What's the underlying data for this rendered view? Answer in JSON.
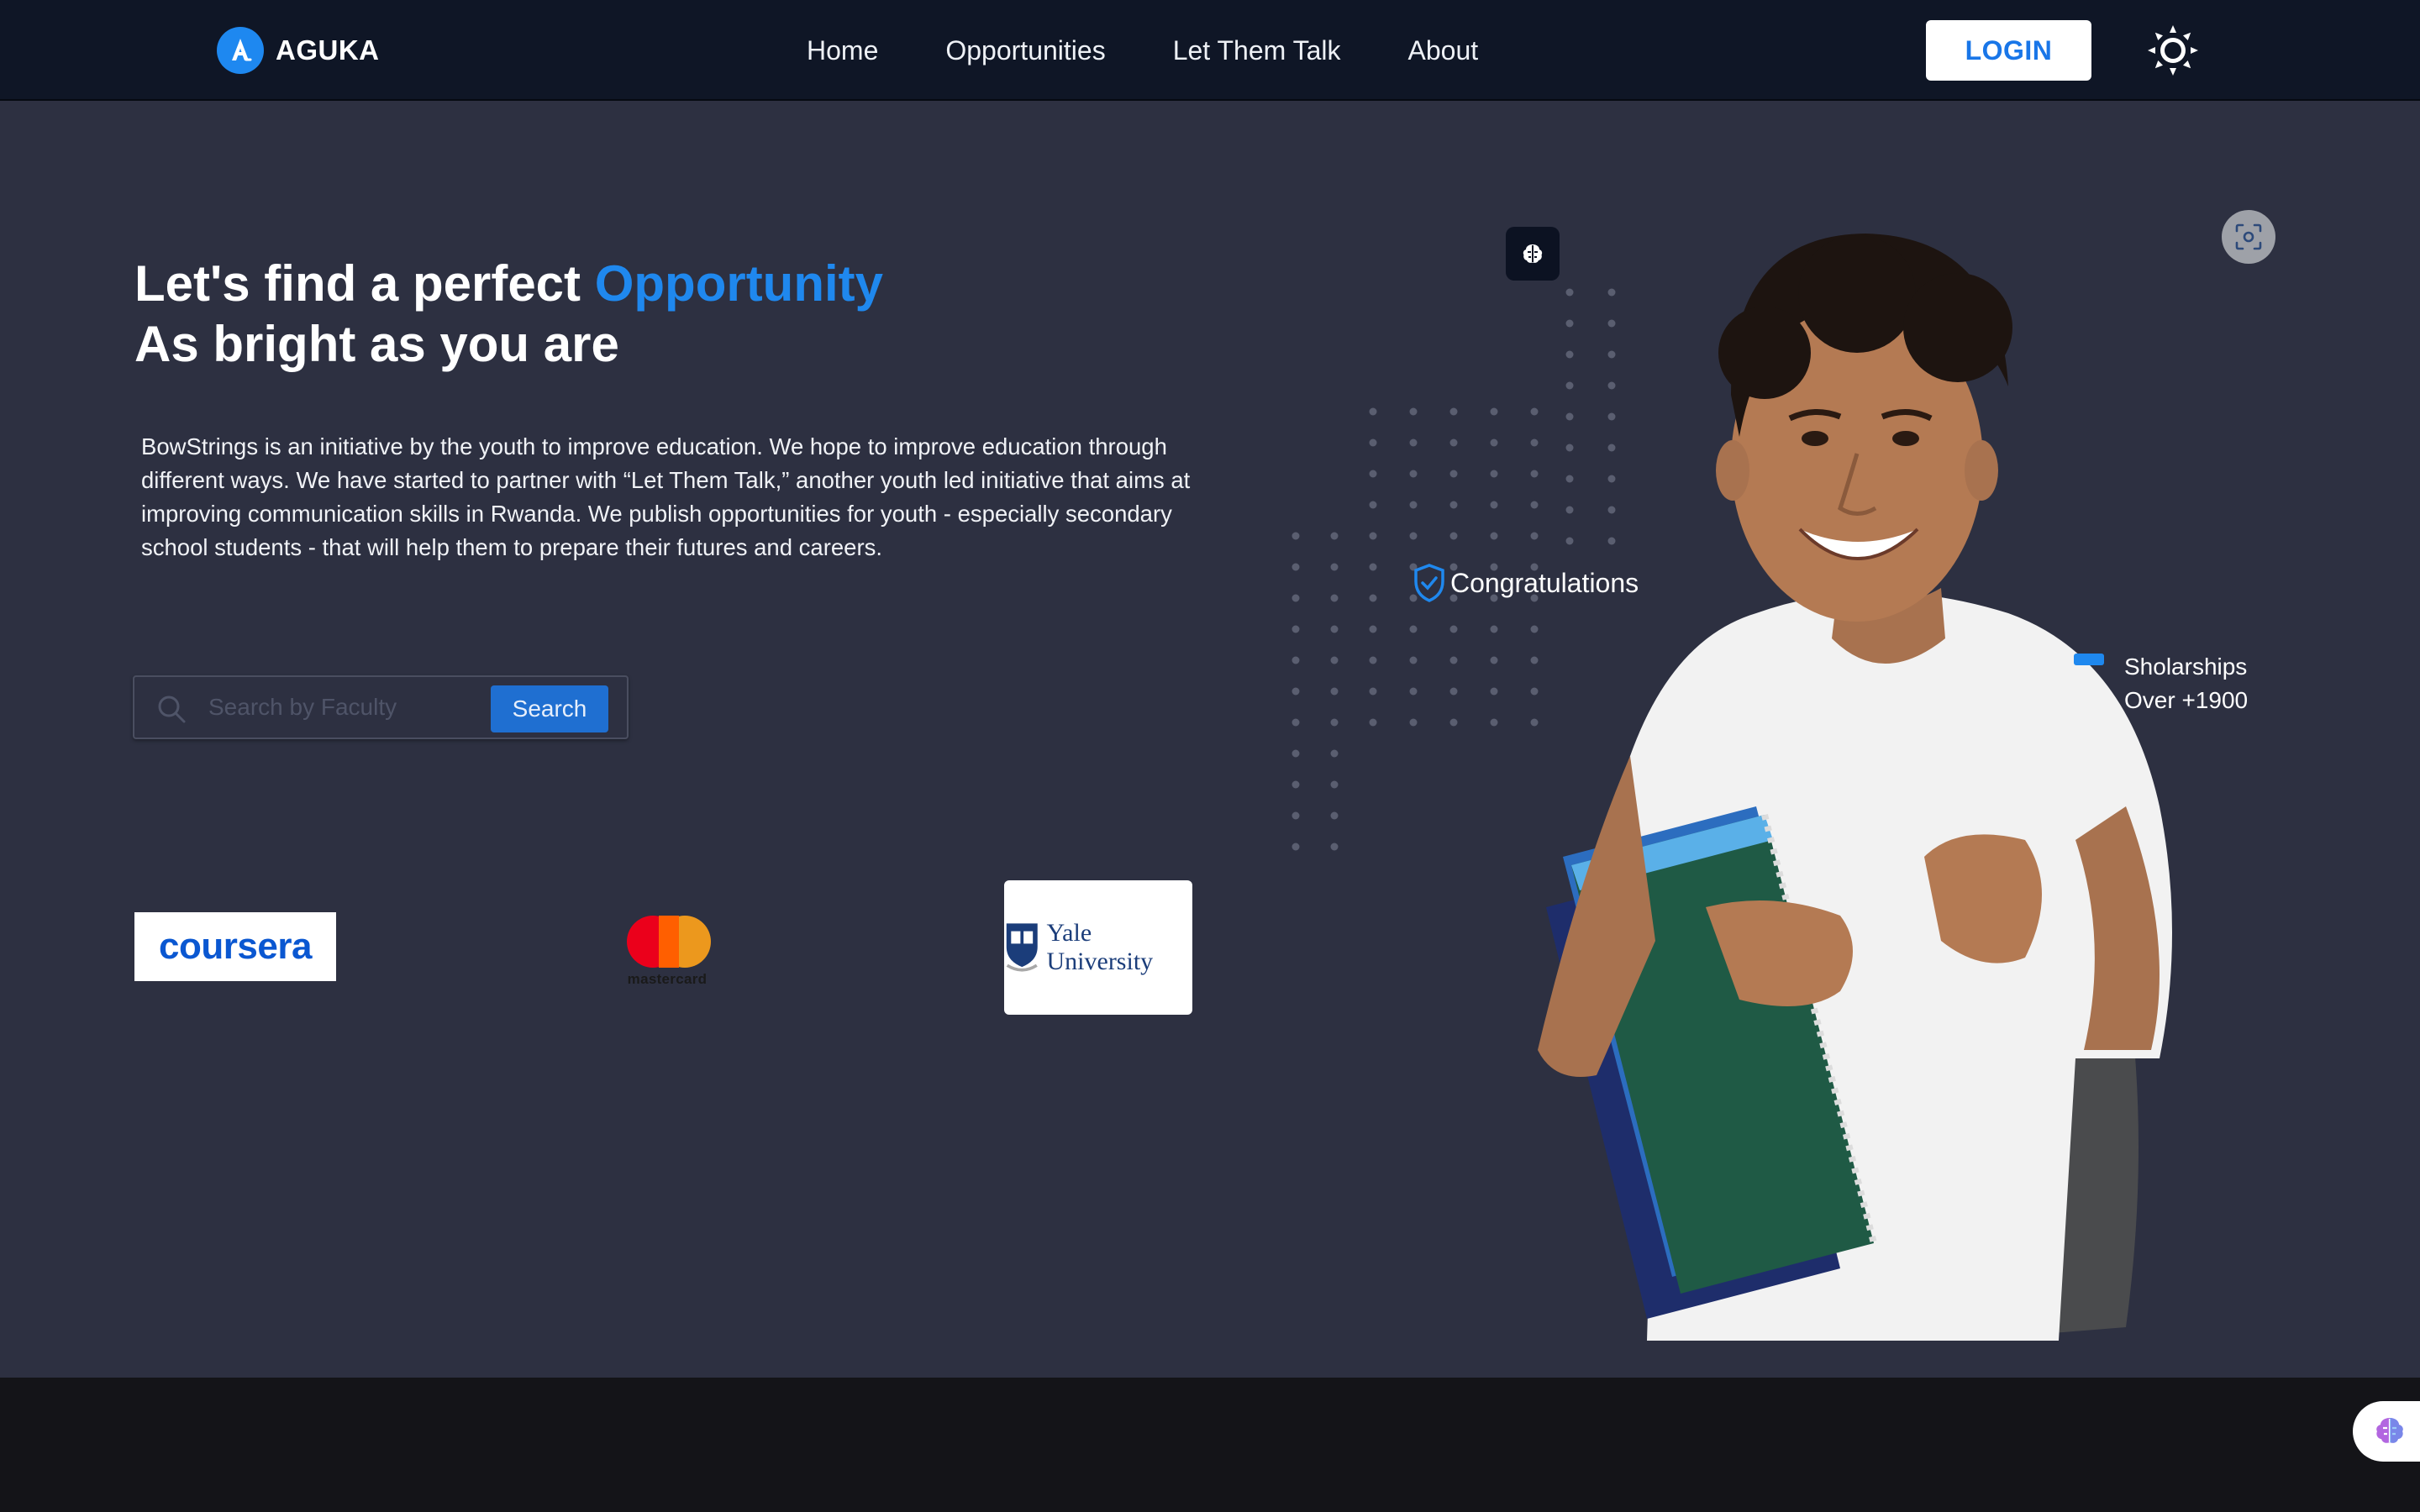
{
  "brand": {
    "name": "AGUKA",
    "logo_icon": "a-logo-icon"
  },
  "nav": {
    "links": [
      "Home",
      "Opportunities",
      "Let Them Talk",
      "About"
    ],
    "login_label": "LOGIN",
    "theme_icon": "sun-icon"
  },
  "hero": {
    "title_part1": "Let's find a perfect ",
    "title_accent": "Opportunity",
    "title_line2": "As bright as you are",
    "description": "BowStrings is an initiative by the youth to improve education. We hope to improve education through different ways. We have started to partner with “Let Them Talk,” another youth led initiative that aims at improving communication skills in Rwanda. We publish opportunities for youth - especially secondary school students - that will help them to prepare their futures and careers."
  },
  "search": {
    "placeholder": "Search by Faculty",
    "button_label": "Search"
  },
  "partners": {
    "coursera": "coursera",
    "mastercard": "mastercard",
    "yale": "Yale University"
  },
  "badges": {
    "congratulations": "Congratulations",
    "scholarships_line1": "Sholarships",
    "scholarships_line2": "Over +1900"
  },
  "colors": {
    "accent": "#1f88ee",
    "navbar": "#0f1626",
    "background": "#2d3041",
    "footer": "#141418"
  }
}
